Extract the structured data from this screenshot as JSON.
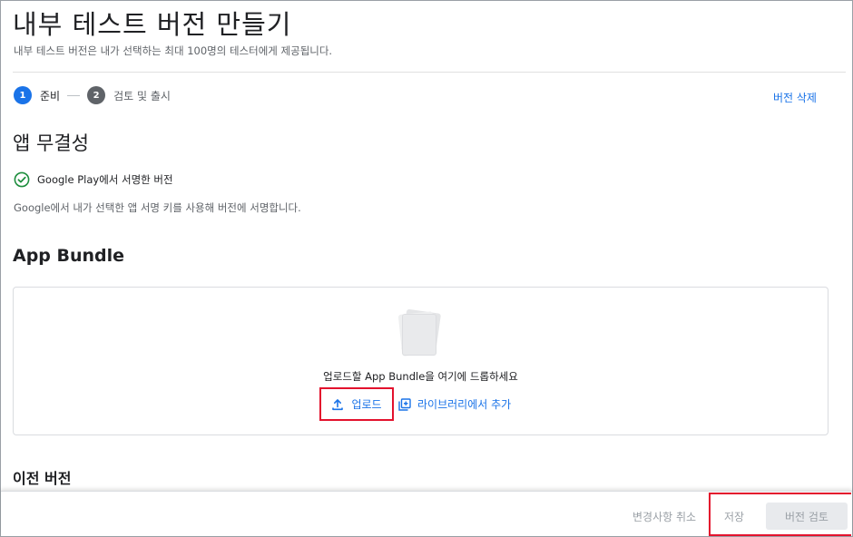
{
  "header": {
    "title": "내부 테스트 버전 만들기",
    "subtitle": "내부 테스트 버전은 내가 선택하는 최대 100명의 테스터에게 제공됩니다."
  },
  "stepper": {
    "steps": [
      {
        "number": "1",
        "label": "준비",
        "state": "active"
      },
      {
        "number": "2",
        "label": "검토 및 출시",
        "state": "inactive"
      }
    ]
  },
  "actions": {
    "delete_release": "버전 삭제"
  },
  "app_integrity": {
    "title": "앱 무결성",
    "signed_label": "Google Play에서 서명한 버전",
    "signed_icon": "check-circle-icon",
    "description": "Google에서 내가 선택한 앱 서명 키를 사용해 버전에 서명합니다."
  },
  "app_bundle": {
    "title": "App Bundle",
    "drop_text": "업로드할 App Bundle을 여기에 드롭하세요",
    "upload_label": "업로드",
    "library_label": "라이브러리에서 추가"
  },
  "previous_versions": {
    "title": "이전 버전"
  },
  "footer": {
    "discard_label": "변경사항 취소",
    "save_label": "저장",
    "review_label": "버전 검토"
  },
  "colors": {
    "accent": "#1a73e8",
    "success": "#1e8e3e",
    "highlight": "#e3122d",
    "disabled": "#9aa0a6"
  }
}
